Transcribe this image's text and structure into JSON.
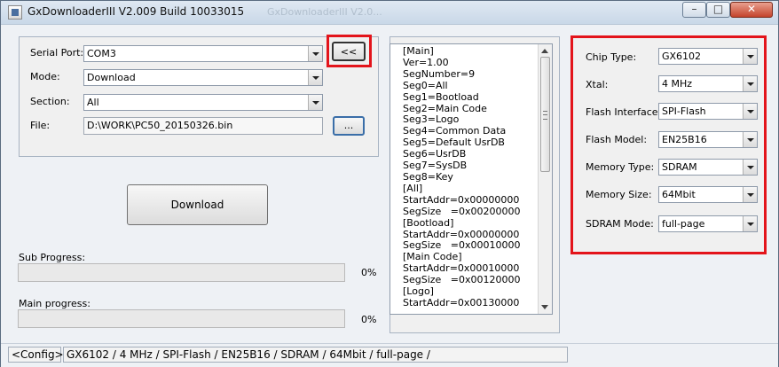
{
  "window": {
    "title": "GxDownloaderIII V2.009 Build 10033015",
    "background_title": "GxDownloaderIII V2.0..."
  },
  "left": {
    "serial_port_label": "Serial Port:",
    "serial_port_value": "COM3",
    "collapse_button": "<<",
    "mode_label": "Mode:",
    "mode_value": "Download",
    "section_label": "Section:",
    "section_value": "All",
    "file_label": "File:",
    "file_value": "D:\\WORK\\PC50_20150326.bin",
    "browse_button": "...",
    "download_button": "Download",
    "sub_progress_label": "Sub Progress:",
    "sub_progress_pct": "0%",
    "sub_progress_value": 0,
    "main_progress_label": "Main progress:",
    "main_progress_pct": "0%",
    "main_progress_value": 0
  },
  "config_list": {
    "lines": [
      "[Main]",
      "Ver=1.00",
      "SegNumber=9",
      "Seg0=All",
      "Seg1=Bootload",
      "Seg2=Main Code",
      "Seg3=Logo",
      "Seg4=Common Data",
      "Seg5=Default UsrDB",
      "Seg6=UsrDB",
      "Seg7=SysDB",
      "Seg8=Key",
      "[All]",
      "StartAddr=0x00000000",
      "SegSize   =0x00200000",
      "[Bootload]",
      "StartAddr=0x00000000",
      "SegSize   =0x00010000",
      "[Main Code]",
      "StartAddr=0x00010000",
      "SegSize   =0x00120000",
      "[Logo]",
      "StartAddr=0x00130000"
    ]
  },
  "right": {
    "chip_type_label": "Chip Type:",
    "chip_type_value": "GX6102",
    "xtal_label": "Xtal:",
    "xtal_value": "4 MHz",
    "flash_interface_label": "Flash Interface:",
    "flash_interface_value": "SPI-Flash",
    "flash_model_label": "Flash Model:",
    "flash_model_value": "EN25B16",
    "memory_type_label": "Memory Type:",
    "memory_type_value": "SDRAM",
    "memory_size_label": "Memory Size:",
    "memory_size_value": "64Mbit",
    "sdram_mode_label": "SDRAM Mode:",
    "sdram_mode_value": "full-page"
  },
  "status": {
    "config_label": "<Config>",
    "config_summary": "GX6102 / 4 MHz / SPI-Flash / EN25B16 / SDRAM / 64Mbit / full-page /"
  },
  "colors": {
    "highlight": "#e3141b"
  }
}
